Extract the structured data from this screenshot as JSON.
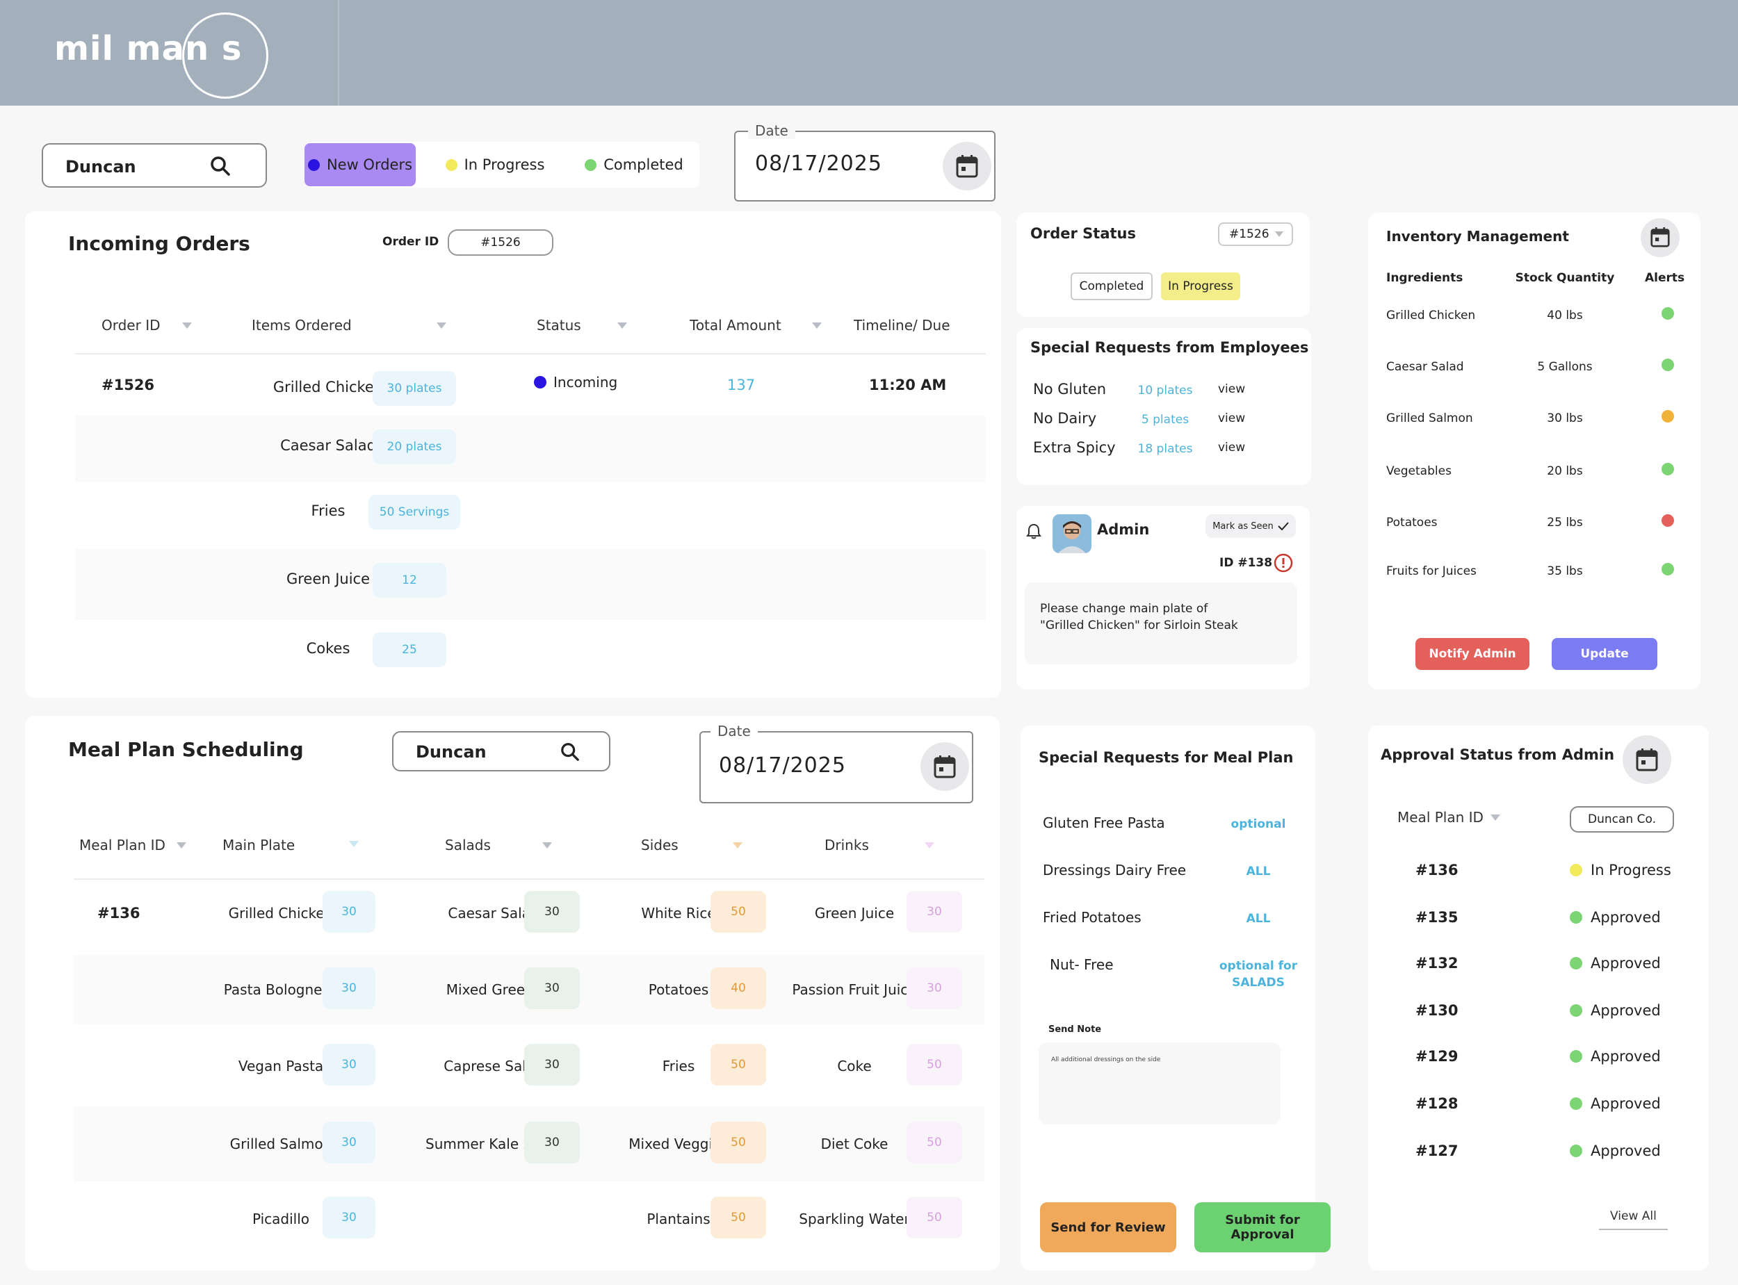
{
  "brand": {
    "logo": "mil man s",
    "colors": {
      "header": "#a3afbb",
      "purple": "#a98af3",
      "blue_dot": "#2a15e0",
      "yellow": "#f3ee8a",
      "green": "#7dd472",
      "chip_blue": "#eaf6fb",
      "chip_blue_text": "#4bb4dd",
      "notify": "#e4605a",
      "update": "#7b7bf2",
      "review": "#f0a95a",
      "approve": "#6cd171"
    },
    "icons": [
      "search-icon",
      "calendar-icon",
      "bell-icon",
      "check-icon",
      "alert-icon",
      "chevron-down-icon"
    ]
  },
  "toolbar": {
    "search_value": "Duncan",
    "filters": [
      {
        "label": "New Orders",
        "dot": "#2a15e0"
      },
      {
        "label": "In Progress",
        "dot": "#f2ea5b"
      },
      {
        "label": "Completed",
        "dot": "#7dd472"
      }
    ],
    "date_label": "Date",
    "date_value": "08/17/2025"
  },
  "incoming": {
    "title": "Incoming Orders",
    "order_id_label": "Order ID",
    "order_id_value": "#1526",
    "columns": [
      "Order ID",
      "Items Ordered",
      "Status",
      "Total Amount",
      "Timeline/ Due"
    ],
    "order": {
      "id": "#1526",
      "status": "Incoming",
      "total": "137",
      "due": "11:20 AM"
    },
    "items": [
      {
        "name": "Grilled Chicken",
        "qty": "30 plates"
      },
      {
        "name": "Caesar Salad",
        "qty": "20 plates"
      },
      {
        "name": "Fries",
        "qty": "50 Servings"
      },
      {
        "name": "Green Juice",
        "qty": "12"
      },
      {
        "name": "Cokes",
        "qty": "25"
      }
    ]
  },
  "order_status": {
    "title": "Order Status",
    "id": "#1526",
    "completed": "Completed",
    "in_progress": "In Progress"
  },
  "special_emp": {
    "title": "Special Requests from Employees",
    "rows": [
      {
        "name": "No Gluten",
        "qty": "10 plates",
        "action": "view"
      },
      {
        "name": "No Dairy",
        "qty": "5 plates",
        "action": "view"
      },
      {
        "name": "Extra Spicy",
        "qty": "18 plates",
        "action": "view"
      }
    ]
  },
  "admin_msg": {
    "name": "Admin",
    "mark_seen": "Mark as Seen",
    "id": "ID #138",
    "message_1": "Please change main plate of",
    "message_2": "\"Grilled Chicken\" for Sirloin Steak"
  },
  "inventory": {
    "title": "Inventory Management",
    "columns": [
      "Ingredients",
      "Stock Quantity",
      "Alerts"
    ],
    "rows": [
      {
        "name": "Grilled Chicken",
        "qty": "40 lbs",
        "alert": "#7dd472"
      },
      {
        "name": "Caesar Salad",
        "qty": "5 Gallons",
        "alert": "#7dd472"
      },
      {
        "name": "Grilled Salmon",
        "qty": "30 lbs",
        "alert": "#f0b23a"
      },
      {
        "name": "Vegetables",
        "qty": "20 lbs",
        "alert": "#7dd472"
      },
      {
        "name": "Potatoes",
        "qty": "25 lbs",
        "alert": "#e4605a"
      },
      {
        "name": "Fruits for Juices",
        "qty": "35 lbs",
        "alert": "#7dd472"
      }
    ],
    "notify": "Notify Admin",
    "update": "Update"
  },
  "meal_plan": {
    "title": "Meal Plan Scheduling",
    "search_value": "Duncan",
    "date_label": "Date",
    "date_value": "08/17/2025",
    "columns": [
      "Meal Plan ID",
      "Main Plate",
      "Salads",
      "Sides",
      "Drinks"
    ],
    "id": "#136",
    "rows": [
      {
        "main": "Grilled Chicken",
        "main_q": "30",
        "salad": "Caesar Salad",
        "salad_q": "30",
        "side": "White Rice",
        "side_q": "50",
        "drink": "Green Juice",
        "drink_q": "30"
      },
      {
        "main": "Pasta Bolognese",
        "main_q": "30",
        "salad": "Mixed Greens",
        "salad_q": "30",
        "side": "Potatoes",
        "side_q": "40",
        "drink": "Passion Fruit Juice",
        "drink_q": "30"
      },
      {
        "main": "Vegan Pasta",
        "main_q": "30",
        "salad": "Caprese Salad",
        "salad_q": "30",
        "side": "Fries",
        "side_q": "50",
        "drink": "Coke",
        "drink_q": "50"
      },
      {
        "main": "Grilled Salmon",
        "main_q": "30",
        "salad": "Summer Kale Salad",
        "salad_q": "30",
        "side": "Mixed Veggies",
        "side_q": "50",
        "drink": "Diet Coke",
        "drink_q": "50"
      },
      {
        "main": "Picadillo",
        "main_q": "30",
        "salad": "",
        "salad_q": "",
        "side": "Plantains",
        "side_q": "50",
        "drink": "Sparkling Water",
        "drink_q": "50"
      }
    ]
  },
  "special_meal": {
    "title": "Special Requests for Meal Plan",
    "rows": [
      {
        "name": "Gluten Free Pasta",
        "value": "optional"
      },
      {
        "name": "Dressings Dairy Free",
        "value": "ALL"
      },
      {
        "name": "Fried Potatoes",
        "value": "ALL"
      },
      {
        "name": "Nut- Free",
        "value": "optional for SALADS"
      }
    ],
    "note_label": "Send Note",
    "note_value": "All additional dressings on the side",
    "review": "Send for Review",
    "submit": "Submit for Approval"
  },
  "approval": {
    "title": "Approval Status from Admin",
    "column": "Meal Plan ID",
    "client": "Duncan Co.",
    "rows": [
      {
        "id": "#136",
        "status": "In Progress",
        "dot": "#f2ea5b"
      },
      {
        "id": "#135",
        "status": "Approved",
        "dot": "#7dd472"
      },
      {
        "id": "#132",
        "status": "Approved",
        "dot": "#7dd472"
      },
      {
        "id": "#130",
        "status": "Approved",
        "dot": "#7dd472"
      },
      {
        "id": "#129",
        "status": "Approved",
        "dot": "#7dd472"
      },
      {
        "id": "#128",
        "status": "Approved",
        "dot": "#7dd472"
      },
      {
        "id": "#127",
        "status": "Approved",
        "dot": "#7dd472"
      }
    ],
    "view_all": "View All"
  }
}
